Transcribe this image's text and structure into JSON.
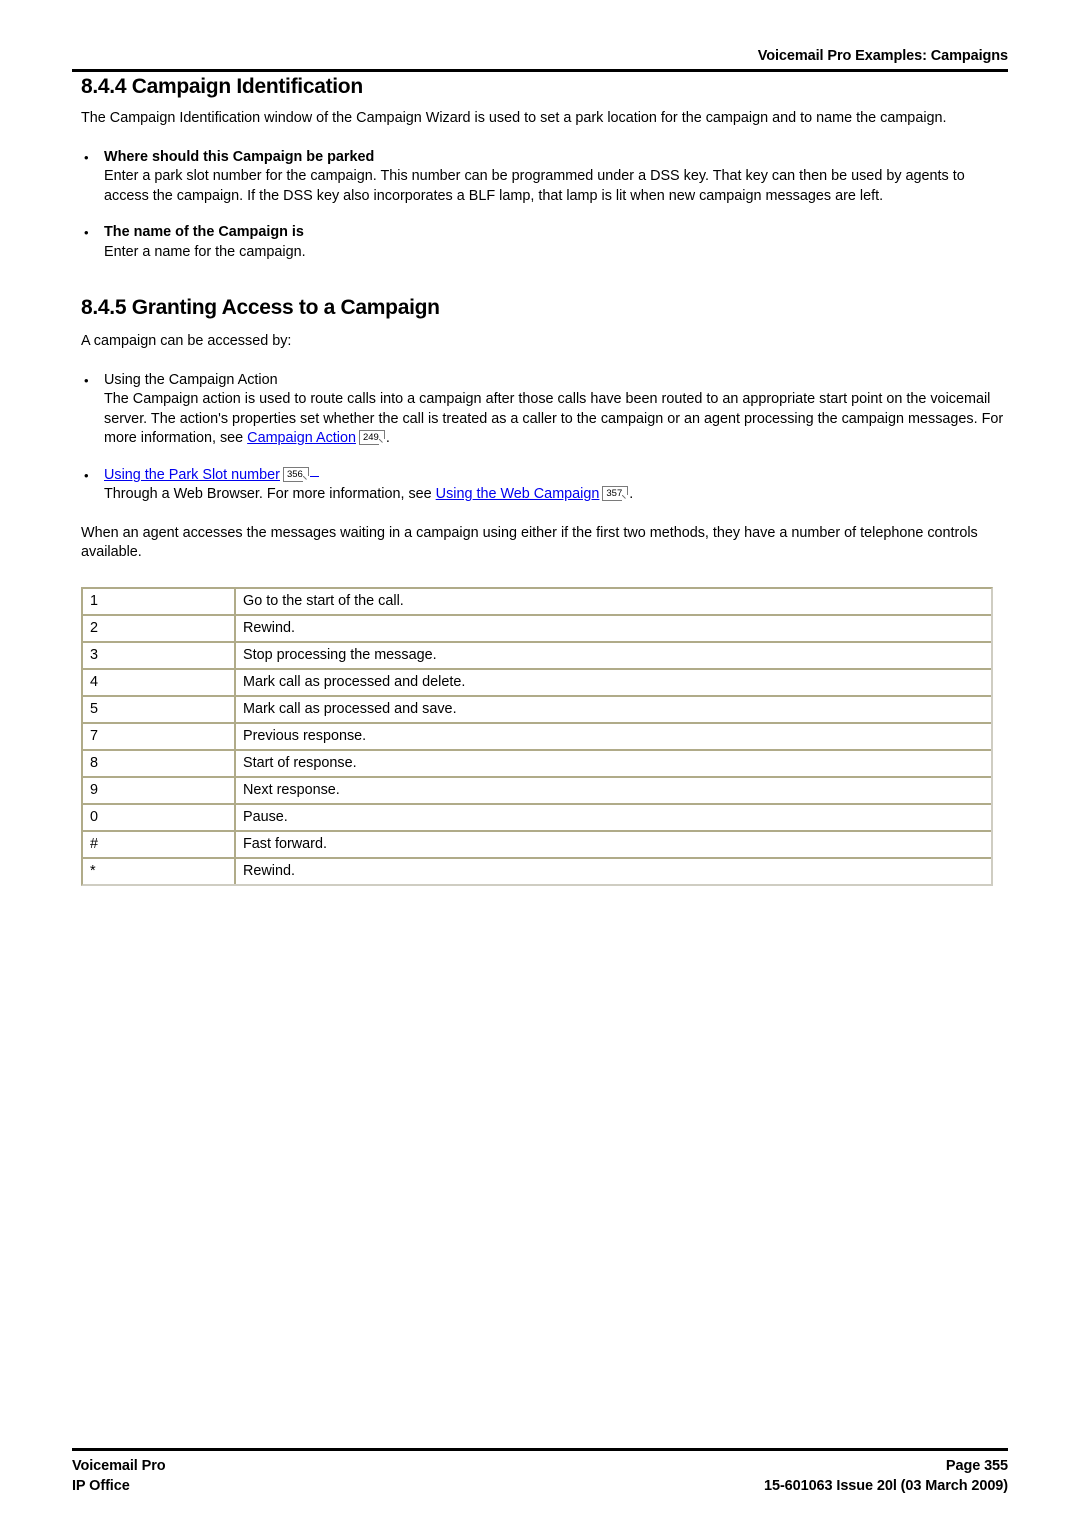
{
  "header": {
    "title": "Voicemail Pro Examples: Campaigns"
  },
  "sections": [
    {
      "heading": "8.4.4 Campaign Identification",
      "intro": "The Campaign Identification window of the Campaign Wizard is used to set a park location for the campaign and to name the campaign.",
      "bullets": [
        {
          "title": "Where should this Campaign be parked",
          "body": "Enter a park slot number for the campaign. This number can be programmed under a DSS key. That key can then be used by agents to access the campaign. If the DSS key also incorporates a BLF lamp, that lamp is lit when new campaign messages are left."
        },
        {
          "title": "The name of the Campaign is",
          "body": "Enter a name for the campaign."
        }
      ]
    },
    {
      "heading": "8.4.5 Granting Access to a Campaign",
      "intro": "A campaign can be accessed by:",
      "bullets": [
        {
          "title": "Using the Campaign Action",
          "body_pre": "The Campaign action is used to route calls into a campaign after those calls have been routed to an appropriate start point on the voicemail server. The action's properties set whether the call is treated as a caller to the campaign or an agent processing the campaign messages. For more information, see ",
          "link_text": "Campaign Action",
          "link_pageref": "249",
          "body_post": "."
        },
        {
          "title_link_text": "Using the Park Slot number",
          "title_pageref": "356",
          "body_pre": "Through a Web Browser. For more information, see ",
          "link_text": "Using the Web Campaign",
          "link_pageref": "357",
          "body_post": "."
        }
      ],
      "closing": "When an agent accesses the messages waiting in a campaign using either if the first two methods, they have a number of telephone controls available."
    }
  ],
  "controls_table": {
    "rows": [
      {
        "key": "1",
        "desc": "Go to the start of the call."
      },
      {
        "key": "2",
        "desc": "Rewind."
      },
      {
        "key": "3",
        "desc": "Stop processing the message."
      },
      {
        "key": "4",
        "desc": "Mark call as processed and delete."
      },
      {
        "key": "5",
        "desc": "Mark call as processed and save."
      },
      {
        "key": "7",
        "desc": "Previous response."
      },
      {
        "key": "8",
        "desc": "Start of response."
      },
      {
        "key": "9",
        "desc": "Next response."
      },
      {
        "key": "0",
        "desc": "Pause."
      },
      {
        "key": "#",
        "desc": "Fast forward."
      },
      {
        "key": "*",
        "desc": "Rewind."
      }
    ]
  },
  "footer": {
    "left_line1": "Voicemail Pro",
    "left_line2": "IP Office",
    "right_line1": "Page 355",
    "right_line2": "15-601063 Issue 20l (03 March 2009)"
  },
  "colors": {
    "link": "#0000ee",
    "table_border": "#b0ab89",
    "rule": "#000000"
  }
}
